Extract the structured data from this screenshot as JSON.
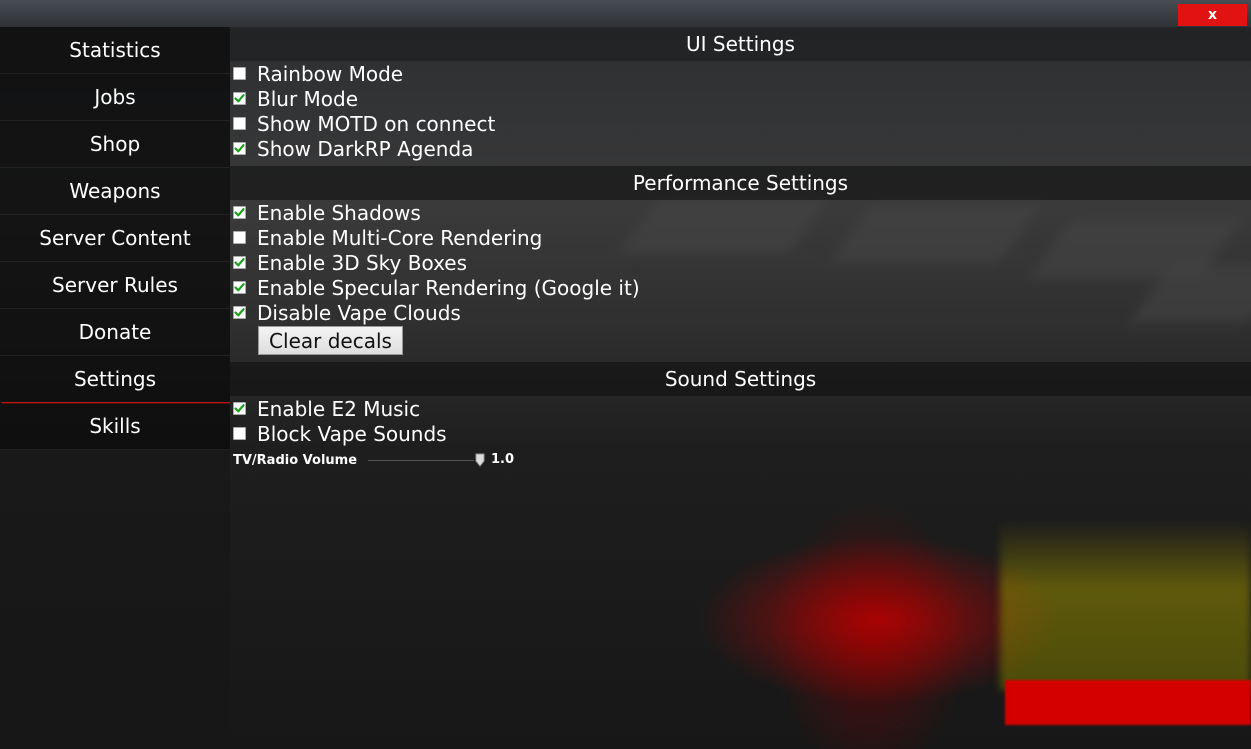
{
  "window": {
    "close_label": "x"
  },
  "sidebar": {
    "items": [
      {
        "label": "Statistics"
      },
      {
        "label": "Jobs"
      },
      {
        "label": "Shop"
      },
      {
        "label": "Weapons"
      },
      {
        "label": "Server Content"
      },
      {
        "label": "Server Rules"
      },
      {
        "label": "Donate"
      },
      {
        "label": "Settings",
        "active": true
      },
      {
        "label": "Skills"
      }
    ]
  },
  "ui_settings": {
    "title": "UI Settings",
    "options": [
      {
        "label": "Rainbow Mode",
        "checked": false
      },
      {
        "label": "Blur Mode",
        "checked": true
      },
      {
        "label": "Show MOTD on connect",
        "checked": false
      },
      {
        "label": "Show DarkRP Agenda",
        "checked": true
      }
    ]
  },
  "performance_settings": {
    "title": "Performance Settings",
    "options": [
      {
        "label": "Enable Shadows",
        "checked": true
      },
      {
        "label": "Enable Multi-Core Rendering",
        "checked": false
      },
      {
        "label": "Enable 3D Sky Boxes",
        "checked": true
      },
      {
        "label": "Enable Specular Rendering (Google it)",
        "checked": true
      },
      {
        "label": "Disable Vape Clouds",
        "checked": true
      }
    ],
    "clear_button": "Clear decals"
  },
  "sound_settings": {
    "title": "Sound Settings",
    "options": [
      {
        "label": "Enable E2 Music",
        "checked": true
      },
      {
        "label": "Block Vape Sounds",
        "checked": false
      }
    ],
    "volume": {
      "label": "TV/Radio Volume",
      "value": "1.0"
    }
  },
  "colors": {
    "close": "#e01212",
    "active_underline": "#c01414",
    "check": "#1aa31a"
  }
}
